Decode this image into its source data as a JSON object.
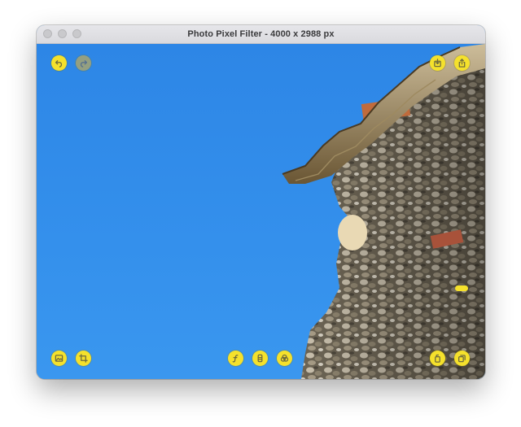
{
  "window": {
    "title": "Photo Pixel Filter - 4000 x 2988 px"
  },
  "toolbar": {
    "undo": {
      "icon": "undo-icon",
      "enabled": true
    },
    "redo": {
      "icon": "redo-icon",
      "enabled": false
    },
    "import": {
      "icon": "import-icon"
    },
    "share": {
      "icon": "share-icon"
    }
  },
  "bottom_bar": {
    "left": [
      {
        "icon": "photo-library-icon"
      },
      {
        "icon": "crop-icon"
      }
    ],
    "center": [
      {
        "icon": "function-icon"
      },
      {
        "icon": "filter-icon"
      },
      {
        "icon": "color-blend-icon"
      }
    ],
    "right": [
      {
        "icon": "copy-icon"
      },
      {
        "icon": "duplicate-icon"
      }
    ]
  },
  "colors": {
    "accent": "#f5e12c",
    "sky": "#2f8be8"
  }
}
